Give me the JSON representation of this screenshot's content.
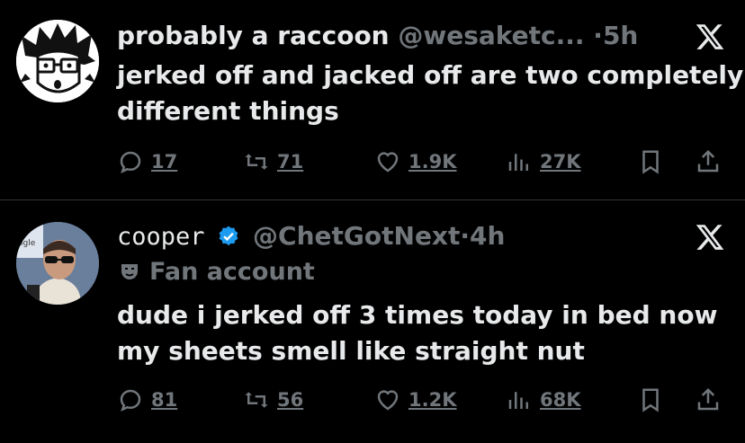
{
  "tweets": [
    {
      "display_name": "probably a raccoon",
      "handle": "@wesaketc...",
      "separator": "·",
      "time": "5h",
      "verified": false,
      "badge": "",
      "text_lines": [
        "jerked off and jacked off are two completely",
        "different things"
      ],
      "replies": "17",
      "retweets": "71",
      "likes": "1.9K",
      "views": "27K",
      "avatar_icon": "cartoon-glasses-avatar"
    },
    {
      "display_name": "cooper",
      "handle": "@ChetGotNext",
      "separator": "·",
      "time": "4h",
      "verified": true,
      "badge": "Fan account",
      "text_lines": [
        "dude i jerked off 3 times today in bed now",
        "my sheets smell like straight nut"
      ],
      "replies": "81",
      "retweets": "56",
      "likes": "1.2K",
      "views": "68K",
      "avatar_icon": "photo-avatar-sunglasses",
      "avatar_caption": "ogle"
    }
  ],
  "colors": {
    "background": "#000000",
    "text": "#e7e9ea",
    "muted": "#71767b",
    "verified": "#1d9bf0",
    "divider": "#2f3336"
  }
}
